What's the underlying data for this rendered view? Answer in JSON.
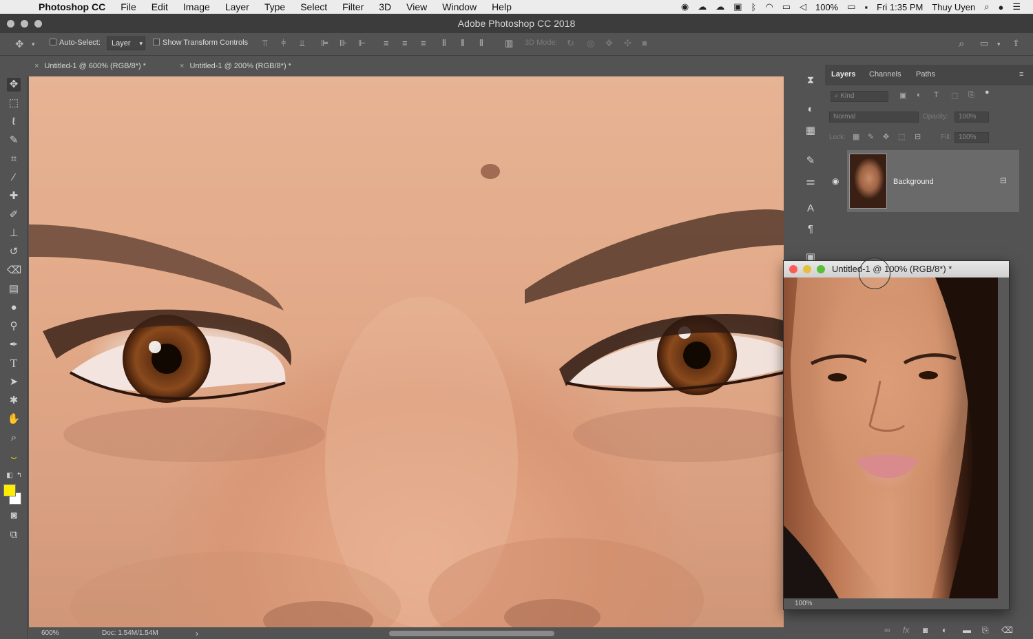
{
  "menubar": {
    "app_name": "Photoshop CC",
    "items": [
      "File",
      "Edit",
      "Image",
      "Layer",
      "Type",
      "Select",
      "Filter",
      "3D",
      "View",
      "Window",
      "Help"
    ],
    "battery": "100%",
    "clock": "Fri 1:35 PM",
    "user": "Thuy Uyen"
  },
  "window": {
    "title": "Adobe Photoshop CC 2018"
  },
  "options": {
    "auto_select_label": "Auto-Select:",
    "auto_select_value": "Layer",
    "show_transform_label": "Show Transform Controls",
    "mode_3d_label": "3D Mode:"
  },
  "tabs": [
    {
      "label": "Untitled-1 @ 600% (RGB/8*) *"
    },
    {
      "label": "Untitled-1 @ 200% (RGB/8*) *"
    }
  ],
  "status": {
    "zoom": "600%",
    "doc": "Doc: 1.54M/1.54M",
    "arrow": "›"
  },
  "layers_panel": {
    "tabs": [
      "Layers",
      "Channels",
      "Paths"
    ],
    "filter_placeholder": "Kind",
    "blend_mode": "Normal",
    "opacity_label": "Opacity:",
    "opacity_value": "100%",
    "lock_label": "Lock:",
    "fill_label": "Fill:",
    "fill_value": "100%",
    "layer_name": "Background"
  },
  "float_window": {
    "title": "Untitled-1 @ 100% (RGB/8*) *",
    "zoom": "100%"
  },
  "colors": {
    "foreground": "#ffee00",
    "background": "#ffffff",
    "ui_panel": "#535353",
    "ui_dark": "#3c3c3c"
  }
}
